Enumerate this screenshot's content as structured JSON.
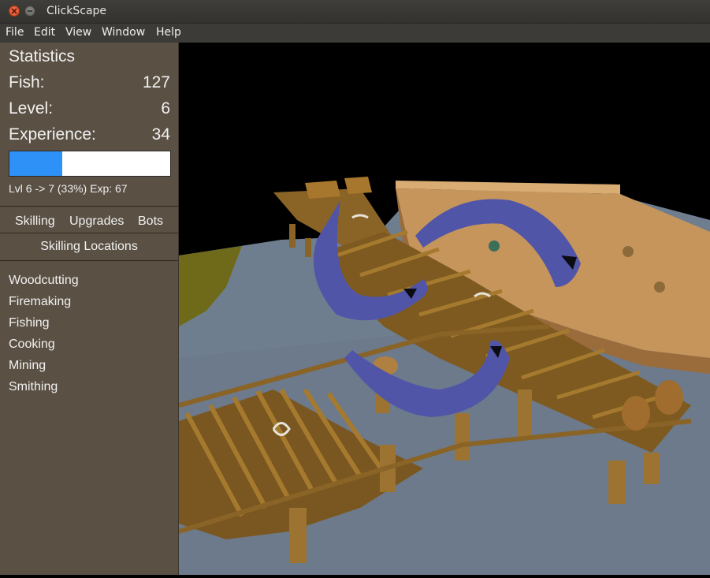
{
  "window": {
    "title": "ClickScape"
  },
  "menu": [
    "File",
    "Edit",
    "View",
    "Window",
    "Help"
  ],
  "statistics": {
    "title": "Statistics",
    "rows": [
      {
        "label": "Fish:",
        "value": "127"
      },
      {
        "label": "Level:",
        "value": "6"
      },
      {
        "label": "Experience:",
        "value": "34"
      }
    ],
    "progress_percent": 33,
    "level_text": "Lvl 6 -> 7 (33%) Exp: 67"
  },
  "tabs": [
    "Skilling",
    "Upgrades",
    "Bots"
  ],
  "skilling": {
    "title": "Skilling Locations",
    "locations": [
      "Woodcutting",
      "Firemaking",
      "Fishing",
      "Cooking",
      "Mining",
      "Smithing"
    ]
  },
  "colors": {
    "progress_fill": "#2e91f7",
    "sidebar_bg": "#5a5044",
    "water": "#6f7e8f",
    "dock": "#8a6326",
    "fish": "#5055a8"
  }
}
